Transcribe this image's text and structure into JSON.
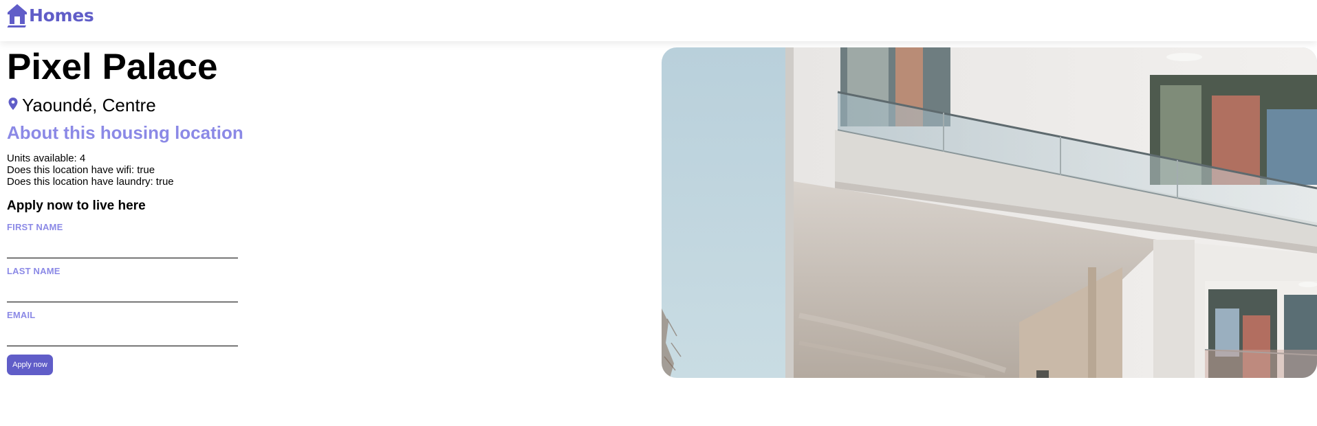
{
  "header": {
    "brand_label": "Homes",
    "brand_icon": "house-icon"
  },
  "listing": {
    "name": "Pixel Palace",
    "location_icon": "map-pin-icon",
    "location": "Yaoundé, Centre",
    "photo_alt": "Exterior photo of Pixel Palace"
  },
  "about": {
    "heading": "About this housing location",
    "units": "Units available: 4",
    "wifi": "Does this location have wifi: true",
    "laundry": "Does this location have laundry: true"
  },
  "form": {
    "heading": "Apply now to live here",
    "first_name_label": "FIRST NAME",
    "first_name_value": "",
    "last_name_label": "LAST NAME",
    "last_name_value": "",
    "email_label": "EMAIL",
    "email_value": "",
    "submit_label": "Apply now"
  },
  "colors": {
    "brand": "#605DC8",
    "accent_light": "#8B89E6"
  }
}
